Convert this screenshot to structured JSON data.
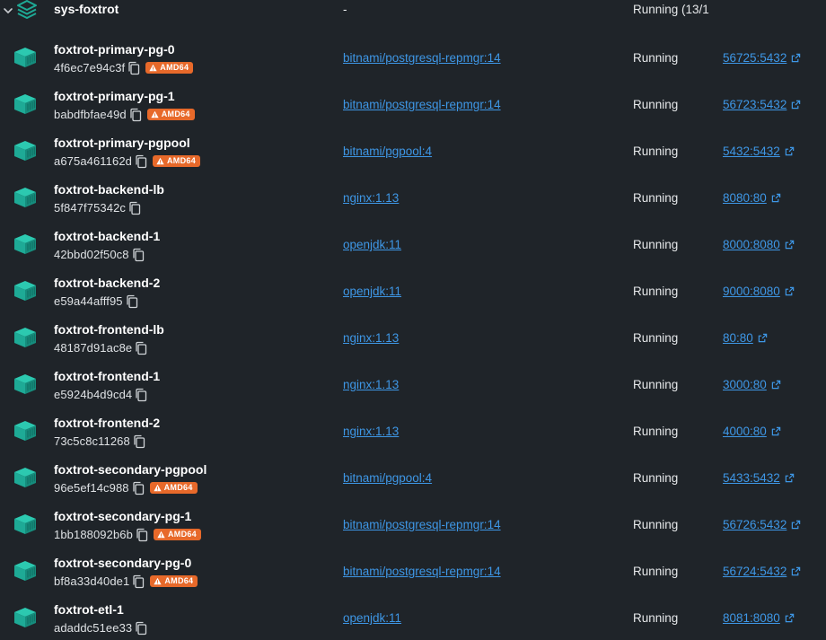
{
  "group": {
    "name": "sys-foxtrot",
    "image": "-",
    "status": "Running (13/1"
  },
  "containers": [
    {
      "name": "foxtrot-primary-pg-0",
      "id": "4f6ec7e94c3f",
      "badge": "AMD64",
      "image": "bitnami/postgresql-repmgr:14",
      "status": "Running",
      "port": "56725:5432"
    },
    {
      "name": "foxtrot-primary-pg-1",
      "id": "babdfbfae49d",
      "badge": "AMD64",
      "image": "bitnami/postgresql-repmgr:14",
      "status": "Running",
      "port": "56723:5432"
    },
    {
      "name": "foxtrot-primary-pgpool",
      "id": "a675a461162d",
      "badge": "AMD64",
      "image": "bitnami/pgpool:4",
      "status": "Running",
      "port": "5432:5432"
    },
    {
      "name": "foxtrot-backend-lb",
      "id": "5f847f75342c",
      "badge": null,
      "image": "nginx:1.13",
      "status": "Running",
      "port": "8080:80"
    },
    {
      "name": "foxtrot-backend-1",
      "id": "42bbd02f50c8",
      "badge": null,
      "image": "openjdk:11",
      "status": "Running",
      "port": "8000:8080"
    },
    {
      "name": "foxtrot-backend-2",
      "id": "e59a44afff95",
      "badge": null,
      "image": "openjdk:11",
      "status": "Running",
      "port": "9000:8080"
    },
    {
      "name": "foxtrot-frontend-lb",
      "id": "48187d91ac8e",
      "badge": null,
      "image": "nginx:1.13",
      "status": "Running",
      "port": "80:80"
    },
    {
      "name": "foxtrot-frontend-1",
      "id": "e5924b4d9cd4",
      "badge": null,
      "image": "nginx:1.13",
      "status": "Running",
      "port": "3000:80"
    },
    {
      "name": "foxtrot-frontend-2",
      "id": "73c5c8c11268",
      "badge": null,
      "image": "nginx:1.13",
      "status": "Running",
      "port": "4000:80"
    },
    {
      "name": "foxtrot-secondary-pgpool",
      "id": "96e5ef14c988",
      "badge": "AMD64",
      "image": "bitnami/pgpool:4",
      "status": "Running",
      "port": "5433:5432"
    },
    {
      "name": "foxtrot-secondary-pg-1",
      "id": "1bb188092b6b",
      "badge": "AMD64",
      "image": "bitnami/postgresql-repmgr:14",
      "status": "Running",
      "port": "56726:5432"
    },
    {
      "name": "foxtrot-secondary-pg-0",
      "id": "bf8a33d40de1",
      "badge": "AMD64",
      "image": "bitnami/postgresql-repmgr:14",
      "status": "Running",
      "port": "56724:5432"
    },
    {
      "name": "foxtrot-etl-1",
      "id": "adaddc51ee33",
      "badge": null,
      "image": "openjdk:11",
      "status": "Running",
      "port": "8081:8080"
    }
  ],
  "colors": {
    "background": "#1f2429",
    "link": "#3e97e6",
    "container_icon": "#1eaa96",
    "badge": "#e7692a"
  },
  "icons": {
    "group": "stack-layers-icon",
    "container": "container-cube-icon",
    "copy": "copy-icon",
    "warning": "warning-icon",
    "external": "external-link-icon",
    "expand": "chevron-down-icon"
  }
}
